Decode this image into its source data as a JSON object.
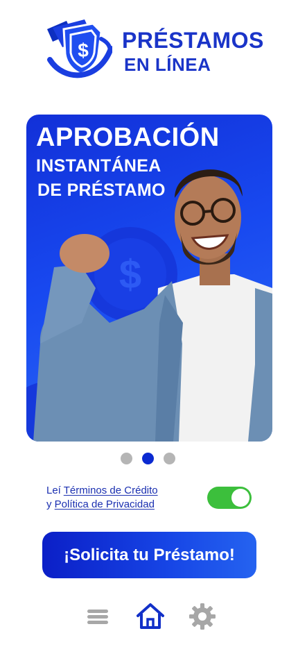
{
  "logo": {
    "line1": "PRÉSTAMOS",
    "line2": "EN LÍNEA",
    "icon": "dollar-shield-icon",
    "color": "#1a34c8"
  },
  "banner": {
    "headline_line1": "APROBACIÓN",
    "headline_line2": "INSTANTÁNEA",
    "headline_line3": "DE PRÉSTAMO",
    "bg_color": "#1849f0"
  },
  "carousel": {
    "pages": 3,
    "active_index": 2
  },
  "terms": {
    "prefix": "Leí ",
    "terms_link": "Términos de Crédito",
    "connector": "y ",
    "privacy_link": "Política de Privacidad",
    "toggle_on": true,
    "toggle_color": "#3cbf3c"
  },
  "cta": {
    "label": "¡Solicita tu Préstamo!"
  },
  "nav": {
    "items": [
      {
        "icon": "menu-icon",
        "active": false
      },
      {
        "icon": "home-icon",
        "active": true
      },
      {
        "icon": "gear-icon",
        "active": false
      }
    ]
  }
}
